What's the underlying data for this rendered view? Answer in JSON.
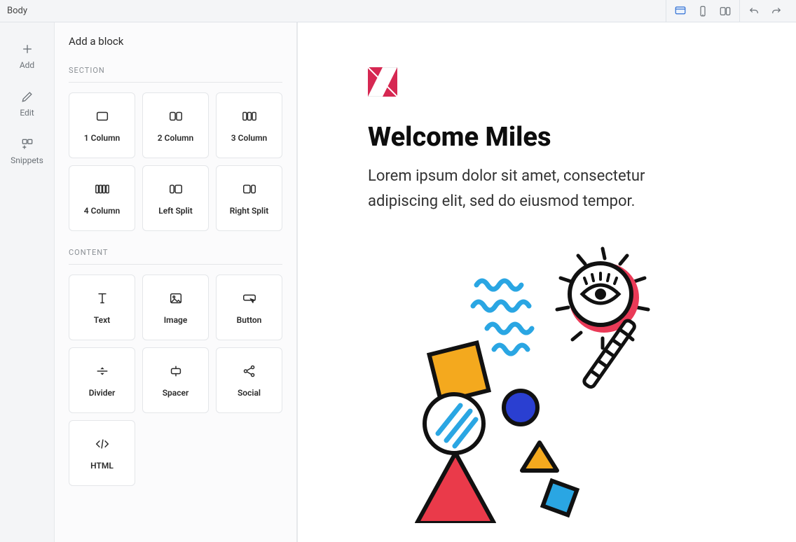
{
  "topbar": {
    "breadcrumb": "Body",
    "viewports": {
      "desktop": "Desktop",
      "mobile": "Mobile",
      "split": "Split"
    },
    "history": {
      "undo": "Undo",
      "redo": "Redo"
    }
  },
  "rail": {
    "add": "Add",
    "edit": "Edit",
    "snippets": "Snippets"
  },
  "picker": {
    "title": "Add a block",
    "section_label": "SECTION",
    "content_label": "CONTENT",
    "section_blocks": {
      "col1": "1 Column",
      "col2": "2 Column",
      "col3": "3 Column",
      "col4": "4 Column",
      "left_split": "Left Split",
      "right_split": "Right Split"
    },
    "content_blocks": {
      "text": "Text",
      "image": "Image",
      "button": "Button",
      "divider": "Divider",
      "spacer": "Spacer",
      "social": "Social",
      "html": "HTML"
    }
  },
  "canvas": {
    "heading": "Welcome Miles",
    "body": "Lorem ipsum dolor sit amet, consectetur adipiscing elit, sed do eiusmod tempor."
  }
}
